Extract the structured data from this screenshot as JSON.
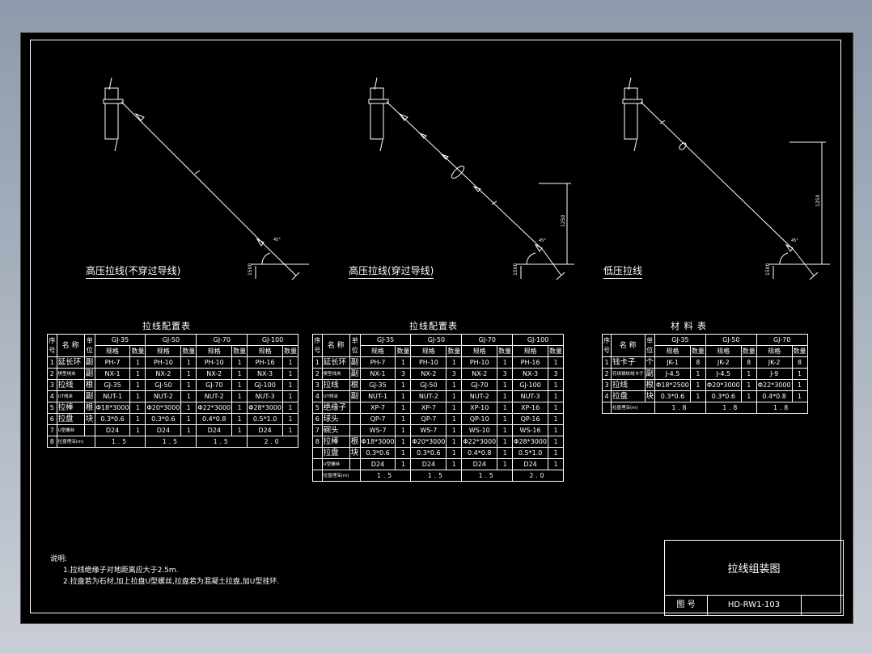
{
  "diagrams": {
    "d1_caption": "高压拉线(不穿过导线)",
    "d2_caption": "高压拉线(穿过导线)",
    "d3_caption": "低压拉线",
    "dim_1500": "1500",
    "dim_1250": "1250"
  },
  "table1": {
    "title": "拉线配置表",
    "header_seq": "序号",
    "header_name": "名 称",
    "header_unit": "单位",
    "groups": [
      "GJ-35",
      "GJ-50",
      "GJ-70",
      "GJ-100"
    ],
    "sub_spec": "规格",
    "sub_qty": "数量",
    "rows": [
      {
        "no": "1",
        "name": "延长环",
        "unit": "副",
        "cells": [
          [
            "PH-7",
            "1"
          ],
          [
            "PH-10",
            "1"
          ],
          [
            "PH-10",
            "1"
          ],
          [
            "PH-16",
            "1"
          ]
        ]
      },
      {
        "no": "2",
        "name": "楔型线夹",
        "unit": "副",
        "cells": [
          [
            "NX-1",
            "1"
          ],
          [
            "NX-2",
            "1"
          ],
          [
            "NX-2",
            "1"
          ],
          [
            "NX-3",
            "1"
          ]
        ]
      },
      {
        "no": "3",
        "name": "拉线",
        "unit": "根",
        "cells": [
          [
            "GJ-35",
            "1"
          ],
          [
            "GJ-50",
            "1"
          ],
          [
            "GJ-70",
            "1"
          ],
          [
            "GJ-100",
            "1"
          ]
        ]
      },
      {
        "no": "4",
        "name": "UT线夹",
        "unit": "副",
        "cells": [
          [
            "NUT-1",
            "1"
          ],
          [
            "NUT-2",
            "1"
          ],
          [
            "NUT-2",
            "1"
          ],
          [
            "NUT-3",
            "1"
          ]
        ]
      },
      {
        "no": "5",
        "name": "拉棒",
        "unit": "根",
        "cells": [
          [
            "Φ18*3000",
            "1"
          ],
          [
            "Φ20*3000",
            "1"
          ],
          [
            "Φ22*3000",
            "1"
          ],
          [
            "Φ28*3000",
            "1"
          ]
        ]
      },
      {
        "no": "6",
        "name": "拉盘",
        "unit": "块",
        "cells": [
          [
            "0.3*0.6",
            "1"
          ],
          [
            "0.3*0.6",
            "1"
          ],
          [
            "0.4*0.8",
            "1"
          ],
          [
            "0.5*1.0",
            "1"
          ]
        ]
      },
      {
        "no": "7",
        "name": "U型螺丝",
        "unit": "",
        "cells": [
          [
            "D24",
            "1"
          ],
          [
            "D24",
            "1"
          ],
          [
            "D24",
            "1"
          ],
          [
            "D24",
            "1"
          ]
        ]
      }
    ],
    "last_row": {
      "no": "8",
      "name": "拉盘埋深(m)",
      "values": [
        "1.5",
        "1.5",
        "1.5",
        "2.0"
      ]
    }
  },
  "table2": {
    "title": "拉线配置表",
    "header_seq": "序号",
    "header_name": "名 称",
    "header_unit": "单位",
    "groups": [
      "GJ-35",
      "GJ-50",
      "GJ-70",
      "GJ-100"
    ],
    "sub_spec": "规格",
    "sub_qty": "数量",
    "rows": [
      {
        "no": "1",
        "name": "延长环",
        "unit": "副",
        "cells": [
          [
            "PH-7",
            "1"
          ],
          [
            "PH-10",
            "1"
          ],
          [
            "PH-10",
            "1"
          ],
          [
            "PH-16",
            "1"
          ]
        ]
      },
      {
        "no": "2",
        "name": "楔型线夹",
        "unit": "副",
        "cells": [
          [
            "NX-1",
            "3"
          ],
          [
            "NX-2",
            "3"
          ],
          [
            "NX-2",
            "3"
          ],
          [
            "NX-3",
            "3"
          ]
        ]
      },
      {
        "no": "3",
        "name": "拉线",
        "unit": "根",
        "cells": [
          [
            "GJ-35",
            "1"
          ],
          [
            "GJ-50",
            "1"
          ],
          [
            "GJ-70",
            "1"
          ],
          [
            "GJ-100",
            "1"
          ]
        ]
      },
      {
        "no": "4",
        "name": "UT线夹",
        "unit": "副",
        "cells": [
          [
            "NUT-1",
            "1"
          ],
          [
            "NUT-2",
            "1"
          ],
          [
            "NUT-2",
            "1"
          ],
          [
            "NUT-3",
            "1"
          ]
        ]
      },
      {
        "no": "5",
        "name": "绝缘子",
        "unit": "",
        "cells": [
          [
            "XP-7",
            "1"
          ],
          [
            "XP-7",
            "1"
          ],
          [
            "XP-10",
            "1"
          ],
          [
            "XP-16",
            "1"
          ]
        ]
      },
      {
        "no": "6",
        "name": "球头",
        "unit": "",
        "cells": [
          [
            "QP-7",
            "1"
          ],
          [
            "QP-7",
            "1"
          ],
          [
            "QP-10",
            "1"
          ],
          [
            "QP-16",
            "1"
          ]
        ]
      },
      {
        "no": "7",
        "name": "碗头",
        "unit": "",
        "cells": [
          [
            "WS-7",
            "1"
          ],
          [
            "WS-7",
            "1"
          ],
          [
            "WS-10",
            "1"
          ],
          [
            "WS-16",
            "1"
          ]
        ]
      },
      {
        "no": "8",
        "name": "拉棒",
        "unit": "根",
        "cells": [
          [
            "Φ18*3000",
            "1"
          ],
          [
            "Φ20*3000",
            "1"
          ],
          [
            "Φ22*3000",
            "1"
          ],
          [
            "Φ28*3000",
            "1"
          ]
        ]
      },
      {
        "no": "",
        "name": "拉盘",
        "unit": "块",
        "cells": [
          [
            "0.3*0.6",
            "1"
          ],
          [
            "0.3*0.6",
            "1"
          ],
          [
            "0.4*0.8",
            "1"
          ],
          [
            "0.5*1.0",
            "1"
          ]
        ]
      },
      {
        "no": "",
        "name": "U型螺丝",
        "unit": "",
        "cells": [
          [
            "D24",
            "1"
          ],
          [
            "D24",
            "1"
          ],
          [
            "D24",
            "1"
          ],
          [
            "D24",
            "1"
          ]
        ]
      }
    ],
    "last_row": {
      "no": "",
      "name": "拉盘埋深(m)",
      "values": [
        "1.5",
        "1.5",
        "1.5",
        "2.0"
      ]
    }
  },
  "table3": {
    "title": "材 料 表",
    "header_seq": "序号",
    "header_name": "名 称",
    "header_unit": "单位",
    "groups": [
      "GJ-35",
      "GJ-50",
      "GJ-70"
    ],
    "sub_spec": "规格",
    "sub_qty": "数量",
    "rows": [
      {
        "no": "1",
        "name": "钱卡子",
        "unit": "个",
        "cells": [
          [
            "JK-1",
            "8"
          ],
          [
            "JK-2",
            "8"
          ],
          [
            "JK-2",
            "8"
          ]
        ]
      },
      {
        "no": "2",
        "name": "花线钢绞线卡子",
        "unit": "副",
        "cells": [
          [
            "J-4.5",
            "1"
          ],
          [
            "J-4.5",
            "1"
          ],
          [
            "J-9",
            "1"
          ]
        ]
      },
      {
        "no": "3",
        "name": "拉线",
        "unit": "根",
        "cells": [
          [
            "Φ18*2500",
            "1"
          ],
          [
            "Φ20*3000",
            "1"
          ],
          [
            "Φ22*3000",
            "1"
          ]
        ]
      },
      {
        "no": "4",
        "name": "拉盘",
        "unit": "块",
        "cells": [
          [
            "0.3*0.6",
            "1"
          ],
          [
            "0.3*0.6",
            "1"
          ],
          [
            "0.4*0.8",
            "1"
          ]
        ]
      }
    ],
    "last_row": {
      "no": "",
      "name": "拉盘埋深(m)",
      "values": [
        "1.8",
        "1.8",
        "1.8"
      ]
    }
  },
  "notes": {
    "heading": "说明:",
    "line1": "1.拉线绝缘子对地距离应大于2.5m.",
    "line2": "2.拉盘若为石材,加上拉盘U型螺丝,拉盘若为混凝土拉盘,加U型挂环."
  },
  "titleblock": {
    "title": "拉线组装图",
    "drawing_no_label": "图 号",
    "drawing_no": "HD-RW1-103"
  }
}
